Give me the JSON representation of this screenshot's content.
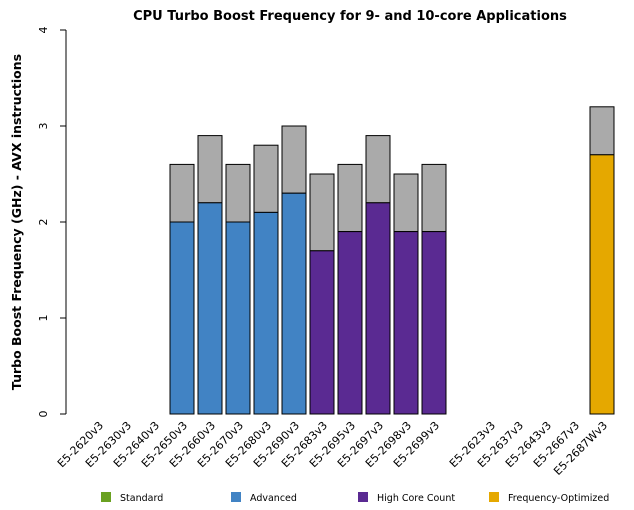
{
  "chart_data": {
    "type": "bar",
    "stacked": true,
    "title": "CPU Turbo Boost Frequency for 9- and 10-core Applications",
    "ylabel": "Turbo Boost Frequency (GHz) - AVX instructions",
    "xlabel": "",
    "ylim": [
      0,
      4
    ],
    "yticks": [
      0,
      1,
      2,
      3,
      4
    ],
    "grid": false,
    "categories": [
      "E5-2620v3",
      "E5-2630v3",
      "E5-2640v3",
      "E5-2650v3",
      "E5-2660v3",
      "E5-2670v3",
      "E5-2680v3",
      "E5-2690v3",
      "E5-2683v3",
      "E5-2695v3",
      "E5-2697v3",
      "E5-2698v3",
      "E5-2699v3",
      "",
      "E5-2623v3",
      "E5-2637v3",
      "E5-2643v3",
      "E5-2667v3",
      "E5-2687Wv3"
    ],
    "groups": [
      "",
      "",
      "",
      "Advanced",
      "Advanced",
      "Advanced",
      "Advanced",
      "Advanced",
      "High Core Count",
      "High Core Count",
      "High Core Count",
      "High Core Count",
      "High Core Count",
      "",
      "",
      "",
      "",
      "",
      "Frequency-Optimized"
    ],
    "base_values": [
      null,
      null,
      null,
      2.0,
      2.2,
      2.0,
      2.1,
      2.3,
      1.7,
      1.9,
      2.2,
      1.9,
      1.9,
      null,
      null,
      null,
      null,
      null,
      2.7
    ],
    "max_turbo_values": [
      null,
      null,
      null,
      2.6,
      2.9,
      2.6,
      2.8,
      3.0,
      2.5,
      2.6,
      2.9,
      2.5,
      2.6,
      null,
      null,
      null,
      null,
      null,
      3.2
    ],
    "turbo_color": "#aaaaaa",
    "legend_position": "bottom",
    "legend": [
      {
        "label": "Standard",
        "color": "#6aa121"
      },
      {
        "label": "Advanced",
        "color": "#4183c4"
      },
      {
        "label": "High Core Count",
        "color": "#5a2a92"
      },
      {
        "label": "Frequency-Optimized",
        "color": "#e5a800"
      }
    ]
  }
}
